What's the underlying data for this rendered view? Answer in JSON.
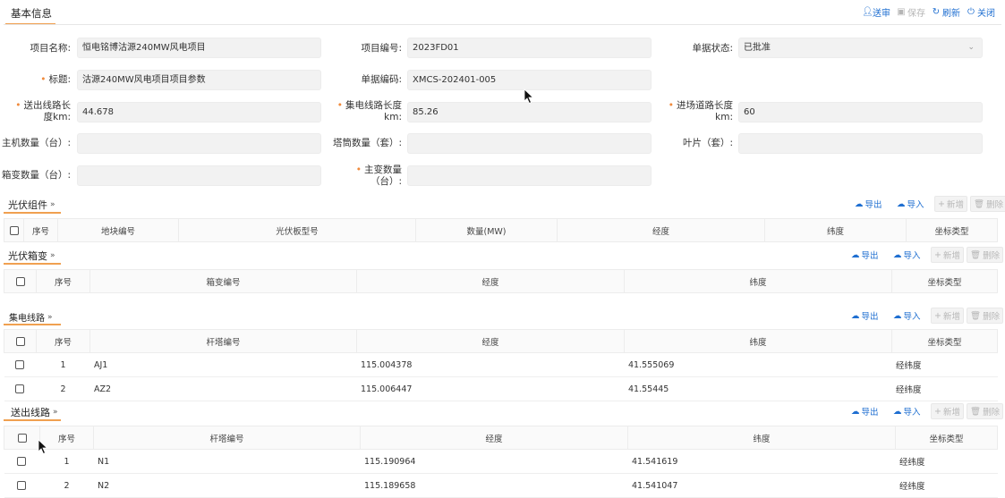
{
  "header": {
    "title": "基本信息",
    "actions": {
      "submit": "送审",
      "save": "保存",
      "refresh": "刷新",
      "close": "关闭"
    }
  },
  "form": {
    "project_name": {
      "label": "项目名称:",
      "value": "恒电铭博沽源240MW风电项目"
    },
    "project_no": {
      "label": "项目编号:",
      "value": "2023FD01"
    },
    "doc_status": {
      "label": "单据状态:",
      "value": "已批准"
    },
    "title": {
      "label": "标题:",
      "value": "沽源240MW风电项目项目参数"
    },
    "doc_code": {
      "label": "单据编码:",
      "value": "XMCS-202401-005"
    },
    "out_line_len": {
      "label_a": "送出线路长",
      "label_b": "度km:",
      "value": "44.678"
    },
    "collect_line_len": {
      "label_a": "集电线路长度",
      "label_b": "km:",
      "value": "85.26"
    },
    "road_len": {
      "label_a": "进场道路长度",
      "label_b": "km:",
      "value": "60"
    },
    "host_count": {
      "label": "主机数量（台）:",
      "value": ""
    },
    "tower_count": {
      "label": "塔筒数量（套）:",
      "value": ""
    },
    "blade_count": {
      "label": "叶片（套）:",
      "value": ""
    },
    "box_count": {
      "label": "箱变数量（台）:",
      "value": ""
    },
    "main_transformer": {
      "label_a": "主变数量",
      "label_b": "（台）:",
      "value": ""
    }
  },
  "buttons": {
    "export": "导出",
    "import": "导入",
    "add": "新增",
    "delete": "删除"
  },
  "sections": {
    "pv": {
      "title": "光伏组件",
      "headers": [
        "序号",
        "地块编号",
        "光伏板型号",
        "数量(MW)",
        "经度",
        "纬度",
        "坐标类型"
      ],
      "rows": []
    },
    "pvbox": {
      "title": "光伏箱变",
      "headers": [
        "序号",
        "箱变编号",
        "经度",
        "纬度",
        "坐标类型"
      ],
      "rows": []
    },
    "collect": {
      "title": "集电线路",
      "headers": [
        "序号",
        "杆塔编号",
        "经度",
        "纬度",
        "坐标类型"
      ],
      "rows": [
        {
          "no": "1",
          "tower": "AJ1",
          "lng": "115.004378",
          "lat": "41.555069",
          "type": "经纬度"
        },
        {
          "no": "2",
          "tower": "AZ2",
          "lng": "115.006447",
          "lat": "41.55445",
          "type": "经纬度"
        }
      ]
    },
    "out": {
      "title": "送出线路",
      "headers": [
        "序号",
        "杆塔编号",
        "经度",
        "纬度",
        "坐标类型"
      ],
      "rows": [
        {
          "no": "1",
          "tower": "N1",
          "lng": "115.190964",
          "lat": "41.541619",
          "type": "经纬度"
        },
        {
          "no": "2",
          "tower": "N2",
          "lng": "115.189658",
          "lat": "41.541047",
          "type": "经纬度"
        }
      ]
    }
  }
}
